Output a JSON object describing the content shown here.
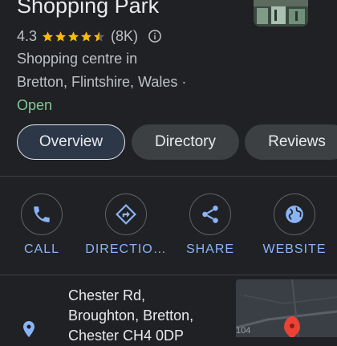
{
  "place": {
    "title": "Shopping Park",
    "rating": "4.3",
    "stars": 4.3,
    "review_count": "(8K)",
    "category_line": "Shopping centre in",
    "location_line": "Bretton, Flintshire, Wales ·",
    "status": "Open"
  },
  "tabs": [
    "Overview",
    "Directory",
    "Reviews"
  ],
  "actions": [
    {
      "label": "CALL",
      "icon": "phone-icon"
    },
    {
      "label": "DIRECTIO…",
      "icon": "directions-icon"
    },
    {
      "label": "SHARE",
      "icon": "share-icon"
    },
    {
      "label": "WEBSITE",
      "icon": "globe-icon"
    }
  ],
  "address": {
    "line1": "Chester Rd,",
    "line2": "Broughton, Bretton,",
    "line3": "Chester CH4 0DP"
  },
  "map": {
    "road_label": "104"
  },
  "colors": {
    "background": "#202124",
    "accent": "#8ab4f8",
    "open_status": "#81c995",
    "star": "#fbbc04",
    "pin": "#ea4335"
  }
}
